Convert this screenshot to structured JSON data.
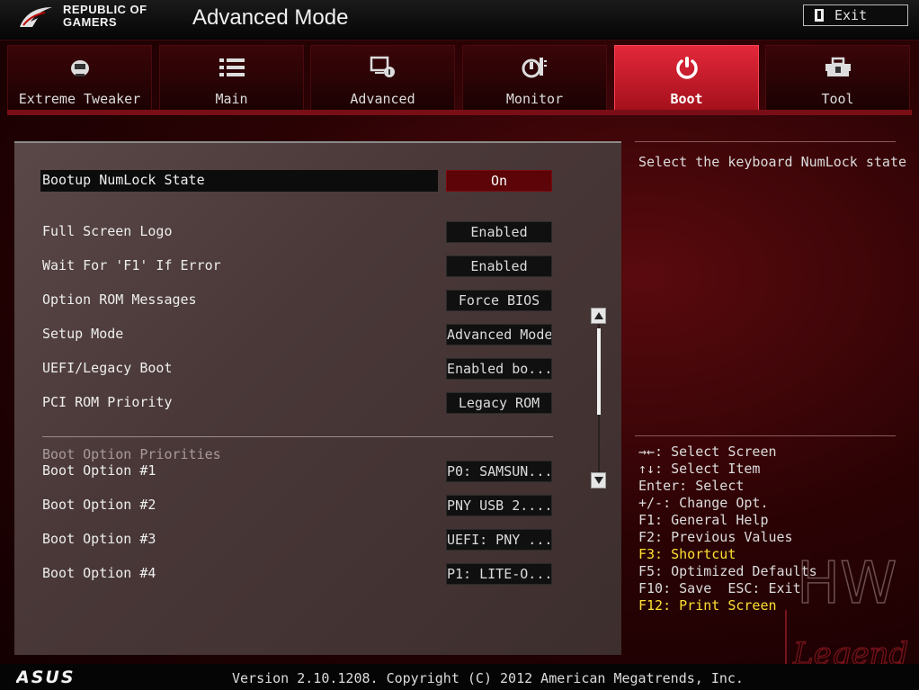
{
  "header": {
    "brand_line1": "REPUBLIC OF",
    "brand_line2": "GAMERS",
    "mode_title": "Advanced Mode",
    "exit_label": "Exit"
  },
  "tabs": [
    {
      "label": "Extreme Tweaker",
      "icon": "tweaker-icon",
      "active": false
    },
    {
      "label": "Main",
      "icon": "list-icon",
      "active": false
    },
    {
      "label": "Advanced",
      "icon": "advanced-icon",
      "active": false
    },
    {
      "label": "Monitor",
      "icon": "monitor-icon",
      "active": false
    },
    {
      "label": "Boot",
      "icon": "power-icon",
      "active": true
    },
    {
      "label": "Tool",
      "icon": "tool-icon",
      "active": false
    }
  ],
  "settings": [
    {
      "label": "Bootup NumLock State",
      "value": "On",
      "selected": true
    },
    {
      "label": "Full Screen Logo",
      "value": "Enabled"
    },
    {
      "label": "Wait For 'F1' If Error",
      "value": "Enabled"
    },
    {
      "label": "Option ROM Messages",
      "value": "Force BIOS"
    },
    {
      "label": "Setup Mode",
      "value": "Advanced Mode"
    },
    {
      "label": "UEFI/Legacy Boot",
      "value": "Enabled bo..."
    },
    {
      "label": "PCI ROM Priority",
      "value": "Legacy ROM"
    }
  ],
  "boot_section": {
    "heading": "Boot Option Priorities",
    "options": [
      {
        "label": "Boot Option #1",
        "value": "P0: SAMSUN..."
      },
      {
        "label": "Boot Option #2",
        "value": "PNY USB 2...."
      },
      {
        "label": "Boot Option #3",
        "value": "UEFI: PNY ..."
      },
      {
        "label": "Boot Option #4",
        "value": "P1: LITE-O..."
      }
    ]
  },
  "help": {
    "description": "Select the keyboard NumLock state",
    "keys": [
      {
        "text": "→←: Select Screen",
        "highlight": false
      },
      {
        "text": "↑↓: Select Item",
        "highlight": false
      },
      {
        "text": "Enter: Select",
        "highlight": false
      },
      {
        "text": "+/-: Change Opt.",
        "highlight": false
      },
      {
        "text": "F1: General Help",
        "highlight": false
      },
      {
        "text": "F2: Previous Values",
        "highlight": false
      },
      {
        "text": "F3: Shortcut",
        "highlight": true
      },
      {
        "text": "F5: Optimized Defaults",
        "highlight": false
      },
      {
        "text": "F10: Save  ESC: Exit",
        "highlight": false
      },
      {
        "text": "F12: Print Screen",
        "highlight": true
      }
    ]
  },
  "footer": {
    "logo_text": "ASUS",
    "version": "Version 2.10.1208. Copyright (C) 2012 American Megatrends, Inc."
  },
  "watermark": {
    "line1": "HW",
    "line2": "Legend"
  },
  "colors": {
    "accent": "#d81f30",
    "highlight_key": "#ffe033",
    "selected_value_bg": "#5c0407"
  }
}
